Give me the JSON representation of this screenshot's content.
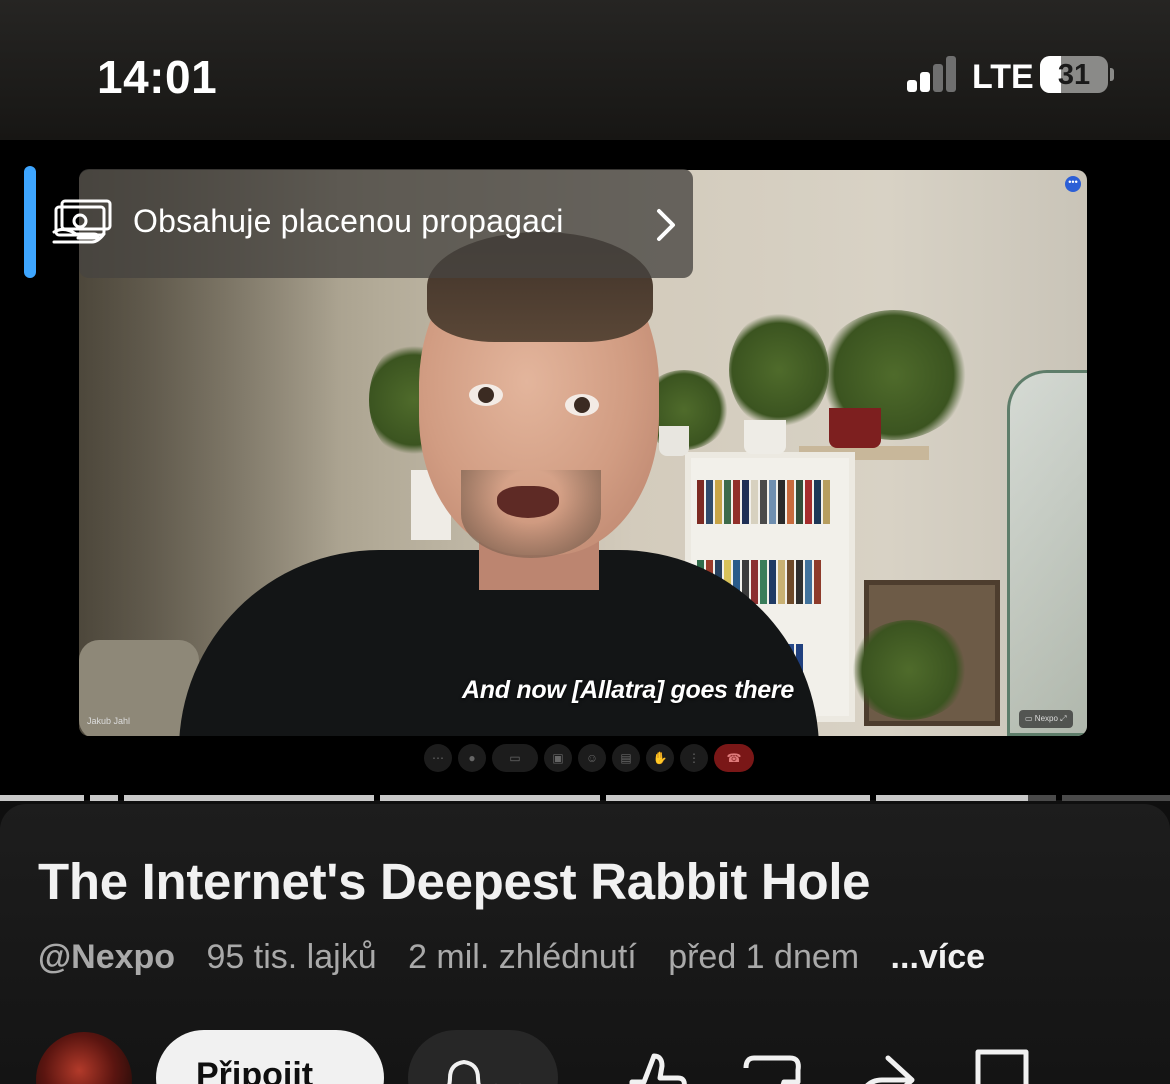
{
  "status_bar": {
    "time": "14:01",
    "network": "LTE",
    "battery_level": "31",
    "battery_fraction": 0.31,
    "signal_bars": 2
  },
  "video": {
    "promo_label": "Obsahuje placenou propagaci",
    "subtitle": "And now [Allatra] goes there",
    "participant_name": "Jakub Jahl",
    "corner_label": "Nexpo",
    "progress_fraction": 0.88
  },
  "info": {
    "title": "The Internet's Deepest Rabbit Hole",
    "channel_handle": "@Nexpo",
    "likes": "95 tis. lajků",
    "views": "2 mil. zhlédnutí",
    "age": "před 1 dnem",
    "more_label": "...více"
  },
  "actions": {
    "join_label": "Připojit",
    "icons": [
      "bell-icon",
      "chevron-down-icon",
      "like-icon",
      "dislike-icon",
      "share-icon",
      "save-icon",
      "more-icon"
    ]
  },
  "colors": {
    "accent": "#3ea6ff",
    "background": "#0f0f0f",
    "end_call": "#7a1717"
  }
}
